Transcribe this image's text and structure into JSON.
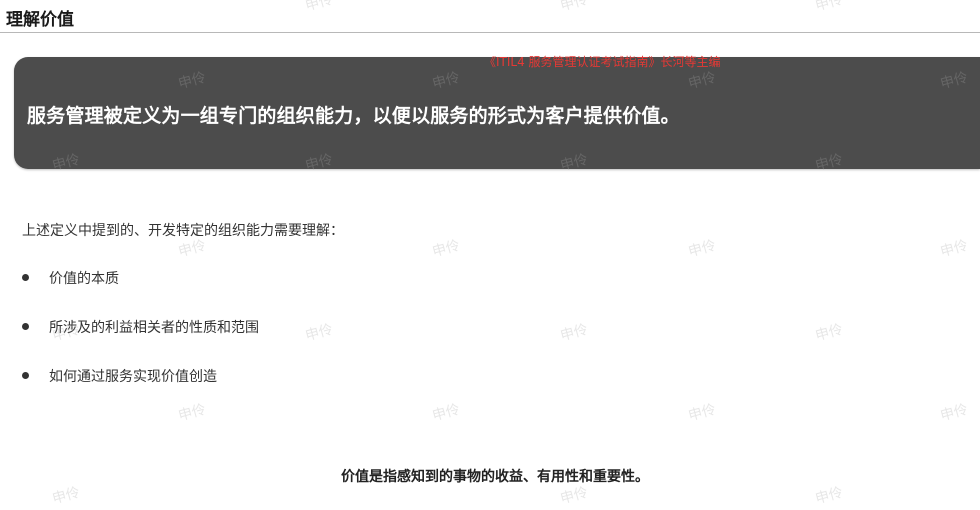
{
  "header": {
    "title": "理解价值"
  },
  "source_note": "《ITIL4 服务管理认证考试指南》长河等主编",
  "banner": {
    "text": "服务管理被定义为一组专门的组织能力，以便以服务的形式为客户提供价值。"
  },
  "body": {
    "intro": "上述定义中提到的、开发特定的组织能力需要理解：",
    "bullets": [
      "价值的本质",
      "所涉及的利益相关者的性质和范围",
      "如何通过服务实现价值创造"
    ],
    "definition": "价值是指感知到的事物的收益、有用性和重要性。"
  },
  "watermark": {
    "text": "申伶"
  },
  "colors": {
    "banner_bg": "#4c4c4c",
    "source_text": "#e53935",
    "header_rule": "#b8b8b8"
  }
}
